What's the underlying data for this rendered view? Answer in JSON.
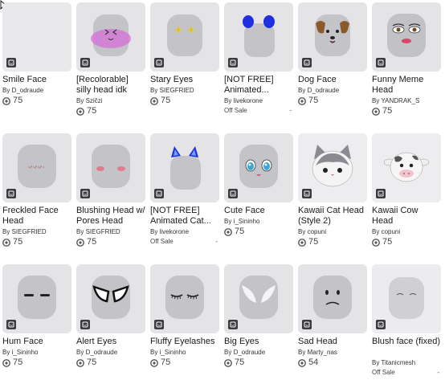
{
  "items": [
    {
      "name": "Smile Face",
      "by": "By",
      "creator": "D_odraude",
      "price": "75"
    },
    {
      "name": "[Recolorable] silly head idk",
      "by": "By",
      "creator": "Szičzi",
      "price": "75"
    },
    {
      "name": "Stary Eyes",
      "by": "By",
      "creator": "SIEGFRIED",
      "price": "75"
    },
    {
      "name": "[NOT FREE] Animated...",
      "by": "By",
      "creator": "livekorone",
      "status": "Off Sale",
      "dash": "-"
    },
    {
      "name": "Dog Face",
      "by": "By",
      "creator": "D_odraude",
      "price": "75"
    },
    {
      "name": "Funny Meme Head",
      "by": "By",
      "creator": "YANDRAK_S",
      "price": "75"
    },
    {
      "name": "Freckled Face Head",
      "by": "By",
      "creator": "SIEGFRIED",
      "price": "75"
    },
    {
      "name": "Blushing Head w/ Pores Head",
      "by": "By",
      "creator": "SIEGFRIED",
      "price": "75"
    },
    {
      "name": "[NOT FREE] Animated Cat...",
      "by": "By",
      "creator": "livekorone",
      "status": "Off Sale",
      "dash": "-"
    },
    {
      "name": "Cute Face",
      "by": "By",
      "creator": "i_Sininho",
      "price": "75"
    },
    {
      "name": "Kawaii Cat Head (Style 2)",
      "by": "By",
      "creator": "copuni",
      "price": "75"
    },
    {
      "name": "Kawaii Cow Head",
      "by": "By",
      "creator": "copuni",
      "price": "75"
    },
    {
      "name": "Hum Face",
      "by": "By",
      "creator": "i_Sininho",
      "price": "75"
    },
    {
      "name": "Alert Eyes",
      "by": "By",
      "creator": "D_odraude",
      "price": "75"
    },
    {
      "name": "Fluffy Eyelashes",
      "by": "By",
      "creator": "i_Sininho",
      "price": "75"
    },
    {
      "name": "Big Eyes",
      "by": "By",
      "creator": "D_odraude",
      "price": "75"
    },
    {
      "name": "Sad Head",
      "by": "By",
      "creator": "Marty_nas",
      "price": "54"
    },
    {
      "name": "Blush face (fixed)",
      "by": "By",
      "creator": "Titanicmesh",
      "status": "Off Sale",
      "dash": "-"
    }
  ],
  "icons": {
    "limited_badge": "limited-badge-icon",
    "currency": "robux-icon",
    "pointer": "cursor-icon"
  },
  "colors": {
    "tile_bg": "#e4e4e7",
    "head_gray": "#b9b9bd",
    "text": "#1a1a1a"
  }
}
